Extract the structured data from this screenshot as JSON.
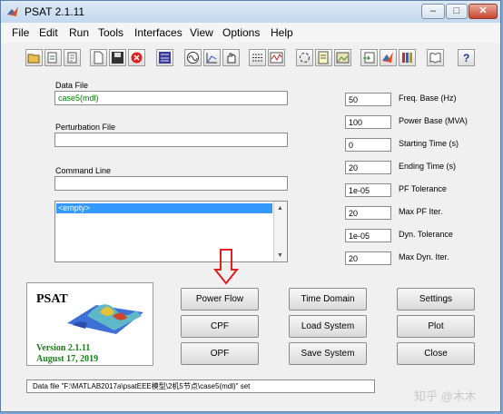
{
  "window": {
    "title": "PSAT 2.1.11"
  },
  "menu": [
    "File",
    "Edit",
    "Run",
    "Tools",
    "Interfaces",
    "View",
    "Options",
    "Help"
  ],
  "left": {
    "data_file_label": "Data File",
    "data_file_value": "case5(mdl)",
    "perturbation_label": "Perturbation File",
    "perturbation_value": "",
    "command_label": "Command Line",
    "command_value": "",
    "list_selected": "<empty>"
  },
  "params": [
    {
      "value": "50",
      "label": "Freq. Base (Hz)"
    },
    {
      "value": "100",
      "label": "Power Base (MVA)"
    },
    {
      "value": "0",
      "label": "Starting Time (s)"
    },
    {
      "value": "20",
      "label": "Ending Time (s)"
    },
    {
      "value": "1e-05",
      "label": "PF Tolerance"
    },
    {
      "value": "20",
      "label": "Max PF Iter."
    },
    {
      "value": "1e-05",
      "label": "Dyn. Tolerance"
    },
    {
      "value": "20",
      "label": "Max Dyn. Iter."
    }
  ],
  "logo": {
    "name": "PSAT",
    "version": "Version 2.1.11",
    "date": "August 17, 2019"
  },
  "buttons": {
    "power_flow": "Power Flow",
    "cpf": "CPF",
    "opf": "OPF",
    "time_domain": "Time Domain",
    "load_system": "Load System",
    "save_system": "Save System",
    "settings": "Settings",
    "plot": "Plot",
    "close": "Close"
  },
  "status": "Data file \"F:\\MATLAB2017a\\psatEEE模型\\2机5节点\\case5(mdl)\" set",
  "watermark": "知乎 @木木",
  "colors": {
    "accent": "#3399ff",
    "green_text": "#008000",
    "arrow": "#e02020"
  }
}
